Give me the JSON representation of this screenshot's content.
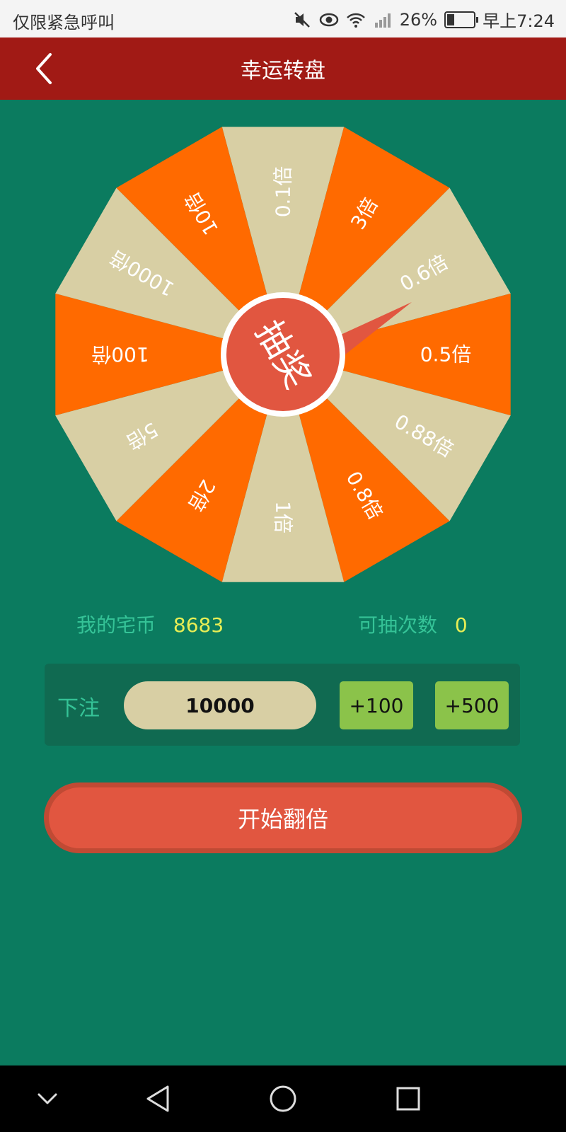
{
  "status_bar": {
    "left_text": "仅限紧急呼叫",
    "battery": "26%",
    "time": "早上7:24",
    "icons": [
      "mute-icon",
      "eye-icon",
      "wifi-icon",
      "signal-icon",
      "battery-icon"
    ]
  },
  "header": {
    "title": "幸运转盘",
    "back_icon": "chevron-left-icon"
  },
  "wheel": {
    "segments": [
      {
        "label": "0.1倍",
        "color": "#d8cfa4"
      },
      {
        "label": "3倍",
        "color": "#ff6a00"
      },
      {
        "label": "0.6倍",
        "color": "#d8cfa4"
      },
      {
        "label": "0.5倍",
        "color": "#ff6a00"
      },
      {
        "label": "0.88倍",
        "color": "#d8cfa4"
      },
      {
        "label": "0.8倍",
        "color": "#ff6a00"
      },
      {
        "label": "1倍",
        "color": "#d8cfa4"
      },
      {
        "label": "2倍",
        "color": "#ff6a00"
      },
      {
        "label": "5倍",
        "color": "#d8cfa4"
      },
      {
        "label": "100倍",
        "color": "#ff6a00"
      },
      {
        "label": "1000倍",
        "color": "#d8cfa4"
      },
      {
        "label": "10倍",
        "color": "#ff6a00"
      }
    ],
    "center_label": "抽奖",
    "center_color": "#e15640"
  },
  "info": {
    "coins_label": "我的宅币",
    "coins_value": "8683",
    "draws_label": "可抽次数",
    "draws_value": "0"
  },
  "bet": {
    "label": "下注",
    "value": "10000",
    "plus100": "+100",
    "plus500": "+500"
  },
  "start_button": "开始翻倍",
  "nav": {
    "icons": [
      "chevron-down-icon",
      "back-triangle-icon",
      "home-circle-icon",
      "recent-square-icon"
    ]
  },
  "colors": {
    "background": "#0b7b5f",
    "header": "#a11a15",
    "accent_orange": "#ff6a00",
    "accent_beige": "#d8cfa4",
    "button_red": "#e15640",
    "button_green": "#8bc34a",
    "label_green": "#35c397",
    "value_yellow": "#e8ee55"
  }
}
